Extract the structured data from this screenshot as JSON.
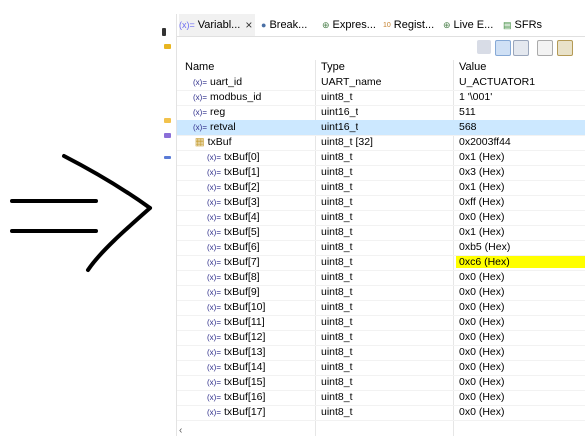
{
  "tabs": [
    {
      "label": "Variabl...",
      "icon": "variable-icon",
      "active": true,
      "closable": true
    },
    {
      "label": "Break...",
      "icon": "breakpoint-icon",
      "active": false
    },
    {
      "label": "Expres...",
      "icon": "expression-icon",
      "active": false
    },
    {
      "label": "Regist...",
      "icon": "register-icon",
      "active": false
    },
    {
      "label": "Live E...",
      "icon": "live-expression-icon",
      "active": false
    },
    {
      "label": "SFRs",
      "icon": "sfr-icon",
      "active": false
    }
  ],
  "columns": {
    "name": "Name",
    "type": "Type",
    "value": "Value"
  },
  "rows": [
    {
      "name": "uart_id",
      "type": "UART_name",
      "value": "U_ACTUATOR1"
    },
    {
      "name": "modbus_id",
      "type": "uint8_t",
      "value": "1 '\\001'"
    },
    {
      "name": "reg",
      "type": "uint16_t",
      "value": "511"
    },
    {
      "name": "retval",
      "type": "uint16_t",
      "value": "568",
      "selected": true
    },
    {
      "name": "txBuf",
      "type": "uint8_t [32]",
      "value": "0x2003ff44",
      "expanded": true
    },
    {
      "name": "txBuf[0]",
      "type": "uint8_t",
      "value": "0x1 (Hex)"
    },
    {
      "name": "txBuf[1]",
      "type": "uint8_t",
      "value": "0x3 (Hex)"
    },
    {
      "name": "txBuf[2]",
      "type": "uint8_t",
      "value": "0x1 (Hex)"
    },
    {
      "name": "txBuf[3]",
      "type": "uint8_t",
      "value": "0xff (Hex)"
    },
    {
      "name": "txBuf[4]",
      "type": "uint8_t",
      "value": "0x0 (Hex)"
    },
    {
      "name": "txBuf[5]",
      "type": "uint8_t",
      "value": "0x1 (Hex)"
    },
    {
      "name": "txBuf[6]",
      "type": "uint8_t",
      "value": "0xb5 (Hex)"
    },
    {
      "name": "txBuf[7]",
      "type": "uint8_t",
      "value": "0xc6 (Hex)",
      "highlight": true
    },
    {
      "name": "txBuf[8]",
      "type": "uint8_t",
      "value": "0x0 (Hex)"
    },
    {
      "name": "txBuf[9]",
      "type": "uint8_t",
      "value": "0x0 (Hex)"
    },
    {
      "name": "txBuf[10]",
      "type": "uint8_t",
      "value": "0x0 (Hex)"
    },
    {
      "name": "txBuf[11]",
      "type": "uint8_t",
      "value": "0x0 (Hex)"
    },
    {
      "name": "txBuf[12]",
      "type": "uint8_t",
      "value": "0x0 (Hex)"
    },
    {
      "name": "txBuf[13]",
      "type": "uint8_t",
      "value": "0x0 (Hex)"
    },
    {
      "name": "txBuf[14]",
      "type": "uint8_t",
      "value": "0x0 (Hex)"
    },
    {
      "name": "txBuf[15]",
      "type": "uint8_t",
      "value": "0x0 (Hex)"
    },
    {
      "name": "txBuf[16]",
      "type": "uint8_t",
      "value": "0x0 (Hex)"
    },
    {
      "name": "txBuf[17]",
      "type": "uint8_t",
      "value": "0x0 (Hex)"
    }
  ],
  "colors": {
    "selected": "#cce8ff",
    "highlight": "#ffff00",
    "accent": "#6d6df2"
  }
}
